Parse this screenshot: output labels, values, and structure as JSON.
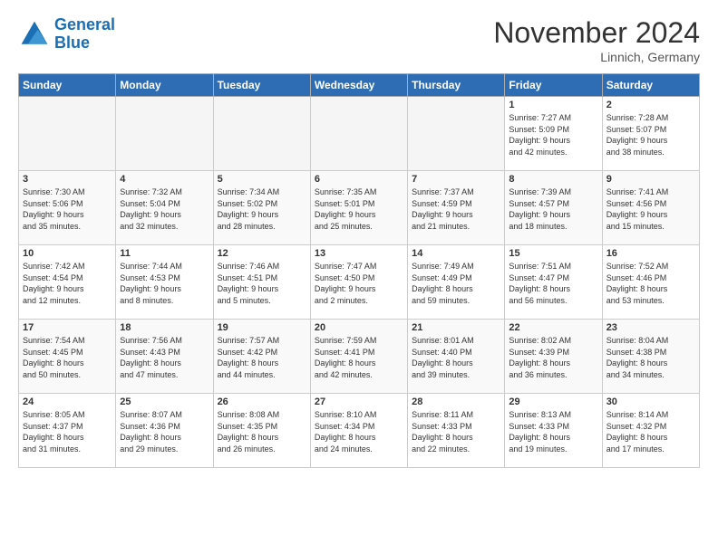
{
  "header": {
    "logo_line1": "General",
    "logo_line2": "Blue",
    "month_title": "November 2024",
    "location": "Linnich, Germany"
  },
  "weekdays": [
    "Sunday",
    "Monday",
    "Tuesday",
    "Wednesday",
    "Thursday",
    "Friday",
    "Saturday"
  ],
  "weeks": [
    [
      {
        "day": "",
        "info": ""
      },
      {
        "day": "",
        "info": ""
      },
      {
        "day": "",
        "info": ""
      },
      {
        "day": "",
        "info": ""
      },
      {
        "day": "",
        "info": ""
      },
      {
        "day": "1",
        "info": "Sunrise: 7:27 AM\nSunset: 5:09 PM\nDaylight: 9 hours\nand 42 minutes."
      },
      {
        "day": "2",
        "info": "Sunrise: 7:28 AM\nSunset: 5:07 PM\nDaylight: 9 hours\nand 38 minutes."
      }
    ],
    [
      {
        "day": "3",
        "info": "Sunrise: 7:30 AM\nSunset: 5:06 PM\nDaylight: 9 hours\nand 35 minutes."
      },
      {
        "day": "4",
        "info": "Sunrise: 7:32 AM\nSunset: 5:04 PM\nDaylight: 9 hours\nand 32 minutes."
      },
      {
        "day": "5",
        "info": "Sunrise: 7:34 AM\nSunset: 5:02 PM\nDaylight: 9 hours\nand 28 minutes."
      },
      {
        "day": "6",
        "info": "Sunrise: 7:35 AM\nSunset: 5:01 PM\nDaylight: 9 hours\nand 25 minutes."
      },
      {
        "day": "7",
        "info": "Sunrise: 7:37 AM\nSunset: 4:59 PM\nDaylight: 9 hours\nand 21 minutes."
      },
      {
        "day": "8",
        "info": "Sunrise: 7:39 AM\nSunset: 4:57 PM\nDaylight: 9 hours\nand 18 minutes."
      },
      {
        "day": "9",
        "info": "Sunrise: 7:41 AM\nSunset: 4:56 PM\nDaylight: 9 hours\nand 15 minutes."
      }
    ],
    [
      {
        "day": "10",
        "info": "Sunrise: 7:42 AM\nSunset: 4:54 PM\nDaylight: 9 hours\nand 12 minutes."
      },
      {
        "day": "11",
        "info": "Sunrise: 7:44 AM\nSunset: 4:53 PM\nDaylight: 9 hours\nand 8 minutes."
      },
      {
        "day": "12",
        "info": "Sunrise: 7:46 AM\nSunset: 4:51 PM\nDaylight: 9 hours\nand 5 minutes."
      },
      {
        "day": "13",
        "info": "Sunrise: 7:47 AM\nSunset: 4:50 PM\nDaylight: 9 hours\nand 2 minutes."
      },
      {
        "day": "14",
        "info": "Sunrise: 7:49 AM\nSunset: 4:49 PM\nDaylight: 8 hours\nand 59 minutes."
      },
      {
        "day": "15",
        "info": "Sunrise: 7:51 AM\nSunset: 4:47 PM\nDaylight: 8 hours\nand 56 minutes."
      },
      {
        "day": "16",
        "info": "Sunrise: 7:52 AM\nSunset: 4:46 PM\nDaylight: 8 hours\nand 53 minutes."
      }
    ],
    [
      {
        "day": "17",
        "info": "Sunrise: 7:54 AM\nSunset: 4:45 PM\nDaylight: 8 hours\nand 50 minutes."
      },
      {
        "day": "18",
        "info": "Sunrise: 7:56 AM\nSunset: 4:43 PM\nDaylight: 8 hours\nand 47 minutes."
      },
      {
        "day": "19",
        "info": "Sunrise: 7:57 AM\nSunset: 4:42 PM\nDaylight: 8 hours\nand 44 minutes."
      },
      {
        "day": "20",
        "info": "Sunrise: 7:59 AM\nSunset: 4:41 PM\nDaylight: 8 hours\nand 42 minutes."
      },
      {
        "day": "21",
        "info": "Sunrise: 8:01 AM\nSunset: 4:40 PM\nDaylight: 8 hours\nand 39 minutes."
      },
      {
        "day": "22",
        "info": "Sunrise: 8:02 AM\nSunset: 4:39 PM\nDaylight: 8 hours\nand 36 minutes."
      },
      {
        "day": "23",
        "info": "Sunrise: 8:04 AM\nSunset: 4:38 PM\nDaylight: 8 hours\nand 34 minutes."
      }
    ],
    [
      {
        "day": "24",
        "info": "Sunrise: 8:05 AM\nSunset: 4:37 PM\nDaylight: 8 hours\nand 31 minutes."
      },
      {
        "day": "25",
        "info": "Sunrise: 8:07 AM\nSunset: 4:36 PM\nDaylight: 8 hours\nand 29 minutes."
      },
      {
        "day": "26",
        "info": "Sunrise: 8:08 AM\nSunset: 4:35 PM\nDaylight: 8 hours\nand 26 minutes."
      },
      {
        "day": "27",
        "info": "Sunrise: 8:10 AM\nSunset: 4:34 PM\nDaylight: 8 hours\nand 24 minutes."
      },
      {
        "day": "28",
        "info": "Sunrise: 8:11 AM\nSunset: 4:33 PM\nDaylight: 8 hours\nand 22 minutes."
      },
      {
        "day": "29",
        "info": "Sunrise: 8:13 AM\nSunset: 4:33 PM\nDaylight: 8 hours\nand 19 minutes."
      },
      {
        "day": "30",
        "info": "Sunrise: 8:14 AM\nSunset: 4:32 PM\nDaylight: 8 hours\nand 17 minutes."
      }
    ]
  ]
}
